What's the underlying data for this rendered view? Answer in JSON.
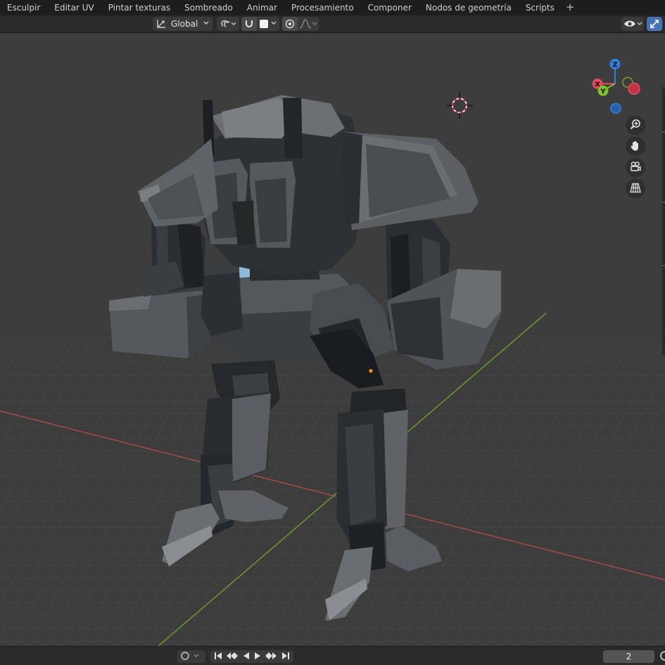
{
  "workspace_tabs": [
    "Esculpir",
    "Editar UV",
    "Pintar texturas",
    "Sombreado",
    "Animar",
    "Procesamiento",
    "Componer",
    "Nodos de geometría",
    "Scripts"
  ],
  "add_workspace_label": "+",
  "header": {
    "orientation_label": "Global",
    "orientation_icon": "transform-orientation-icon",
    "pivot_icon": "pivot-point-icon",
    "snap_icon": "magnet-icon",
    "proportional_icon": "proportional-edit-icon",
    "visibility_icon": "eye-icon",
    "gizmo_icon": "gizmo-toggle-icon"
  },
  "gizmo": {
    "z_label": "Z",
    "x_label": "X",
    "y_label": "Y",
    "colors": {
      "x": "#e44a5c",
      "y": "#7fc227",
      "z": "#2f7fe0"
    }
  },
  "nav_icons": [
    "zoom-icon",
    "pan-hand-icon",
    "camera-icon",
    "perspective-grid-icon"
  ],
  "timeline": {
    "current_frame": "2",
    "keyframe_icon": "keyframe-circle-icon",
    "playback_icons": [
      "jump-start-icon",
      "prev-keyframe-icon",
      "play-reverse-icon",
      "play-icon",
      "next-keyframe-icon",
      "jump-end-icon"
    ]
  },
  "colors": {
    "viewport_bg": "#3d3d3d",
    "x_axis_line": "#a94a4a",
    "y_axis_line": "#6a9a2a",
    "accent": "#4772b3"
  }
}
